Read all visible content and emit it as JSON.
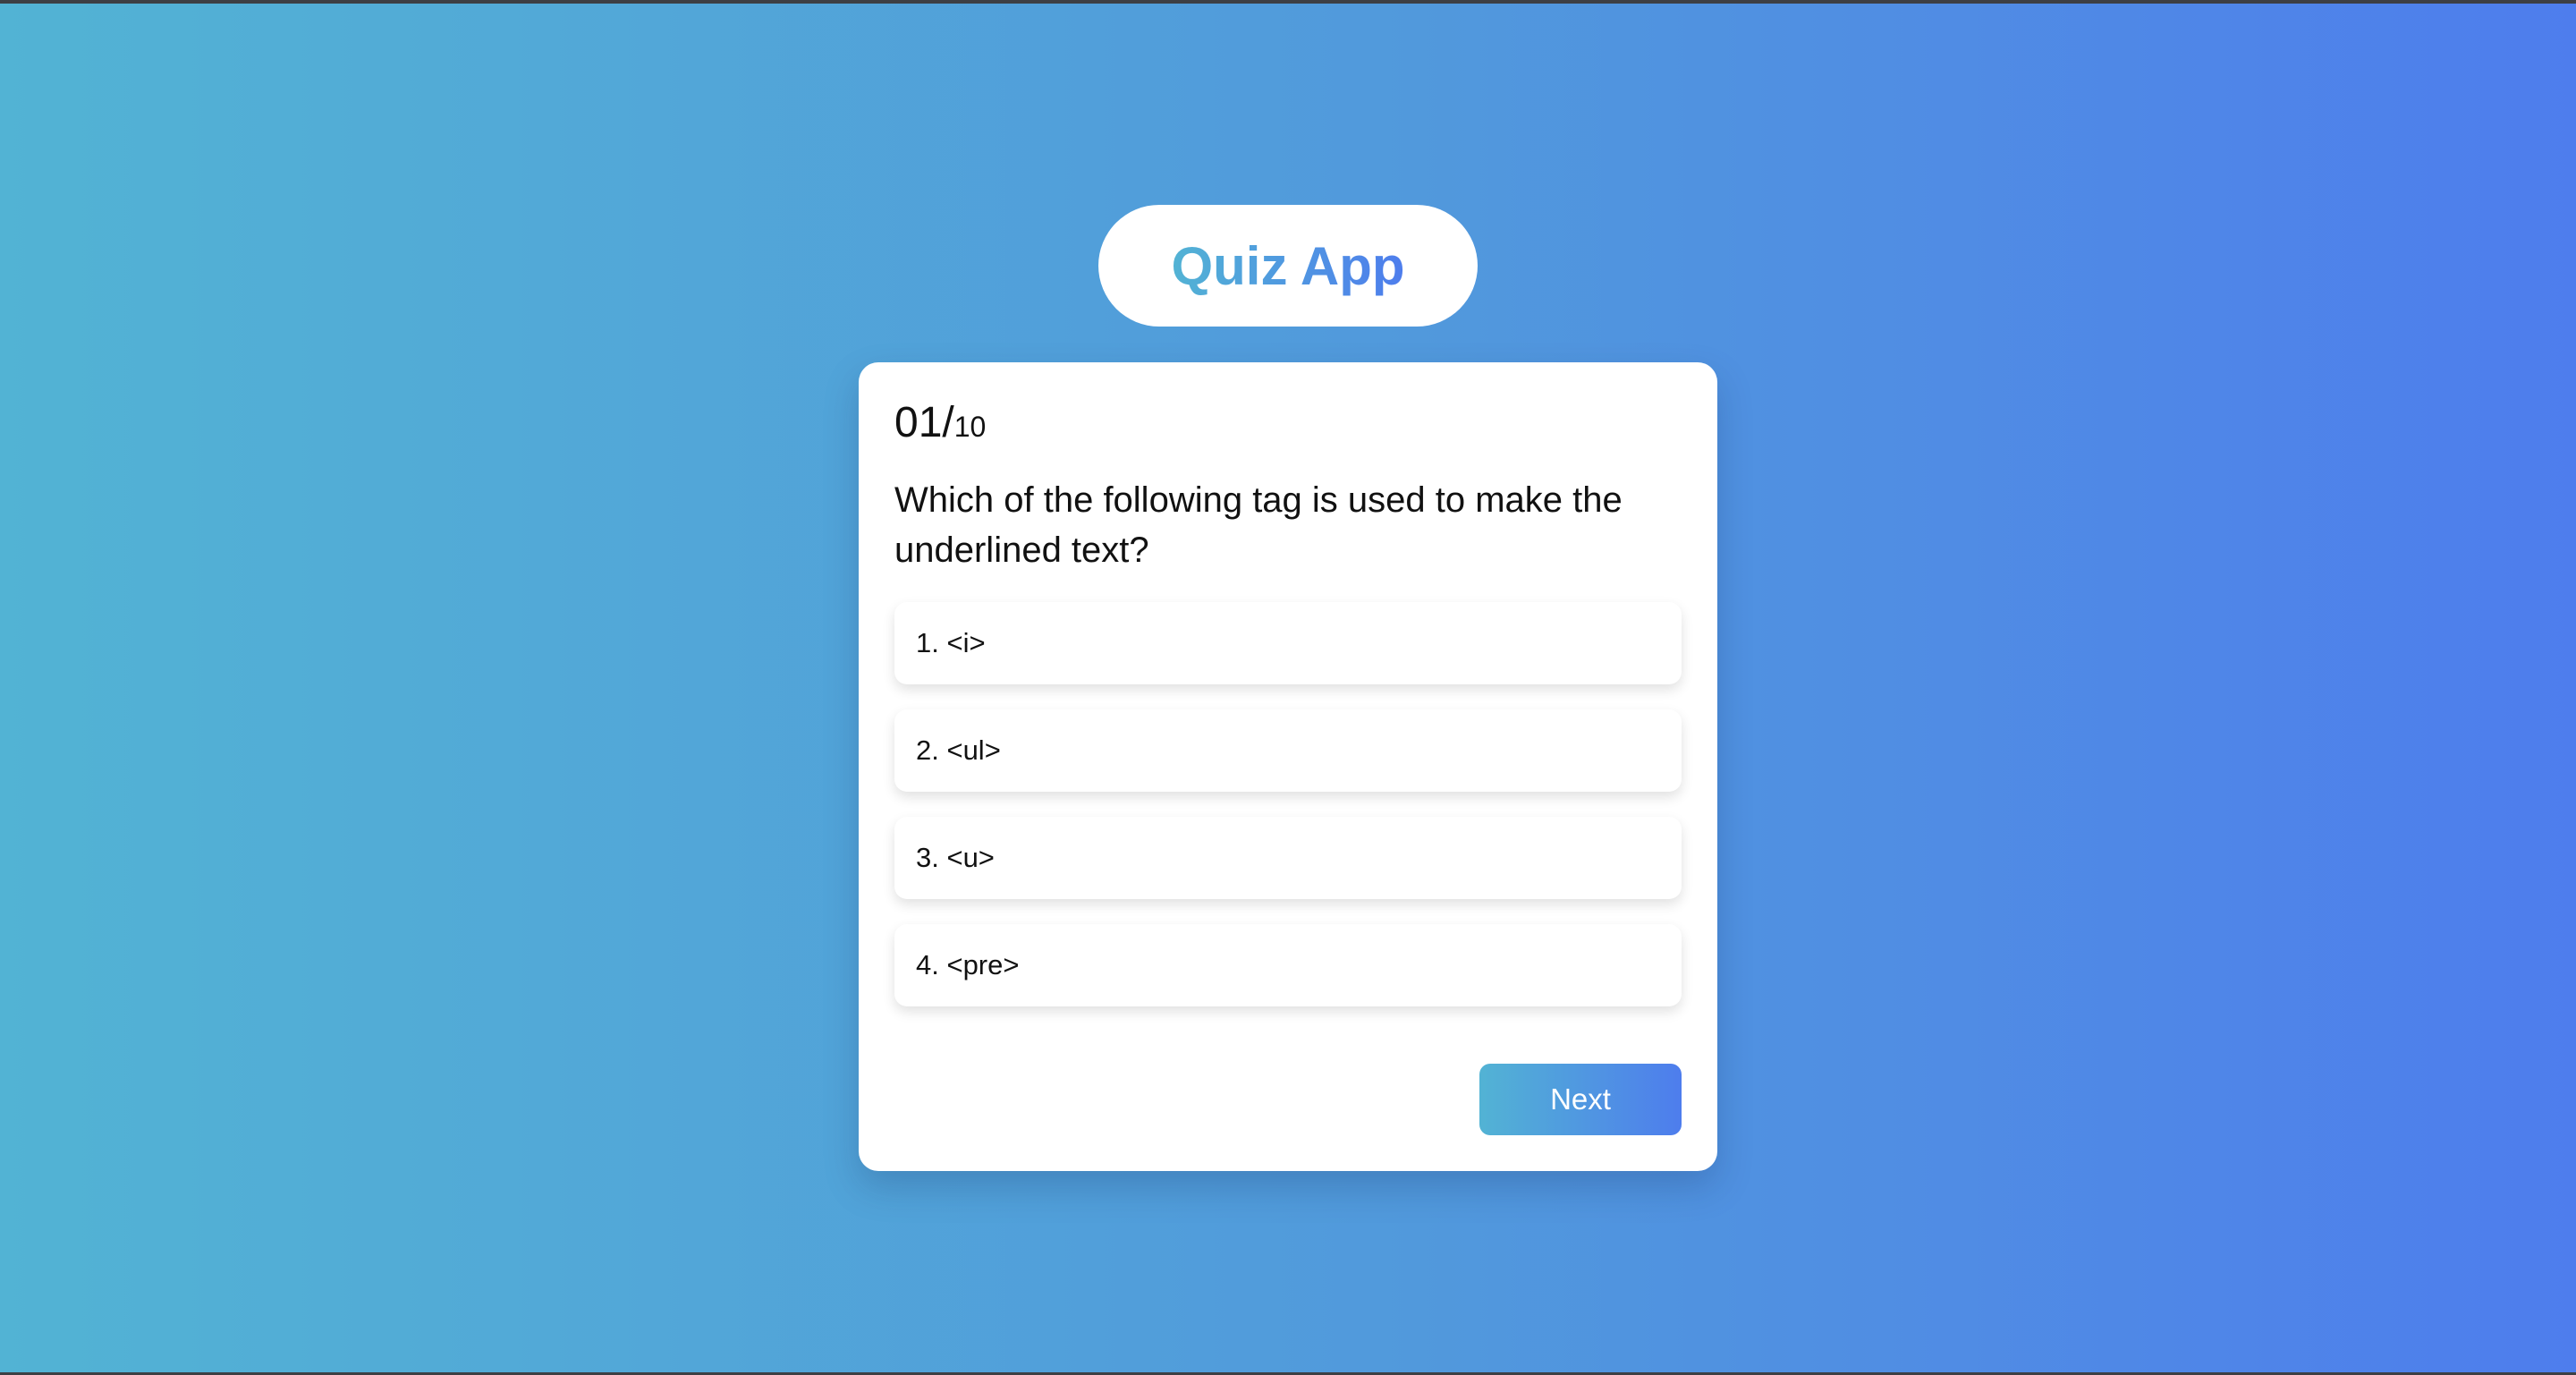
{
  "app": {
    "title": "Quiz App"
  },
  "quiz": {
    "counter_current": "01/",
    "counter_total": "10",
    "question": "Which of the following tag is used to make the underlined text?",
    "options": [
      "1. <i>",
      "2. <ul>",
      "3. <u>",
      "4. <pre>"
    ],
    "next_label": "Next"
  },
  "colors": {
    "gradient_start": "#52b3d4",
    "gradient_end": "#4e7ded",
    "card_background": "#ffffff",
    "text": "#111111"
  }
}
